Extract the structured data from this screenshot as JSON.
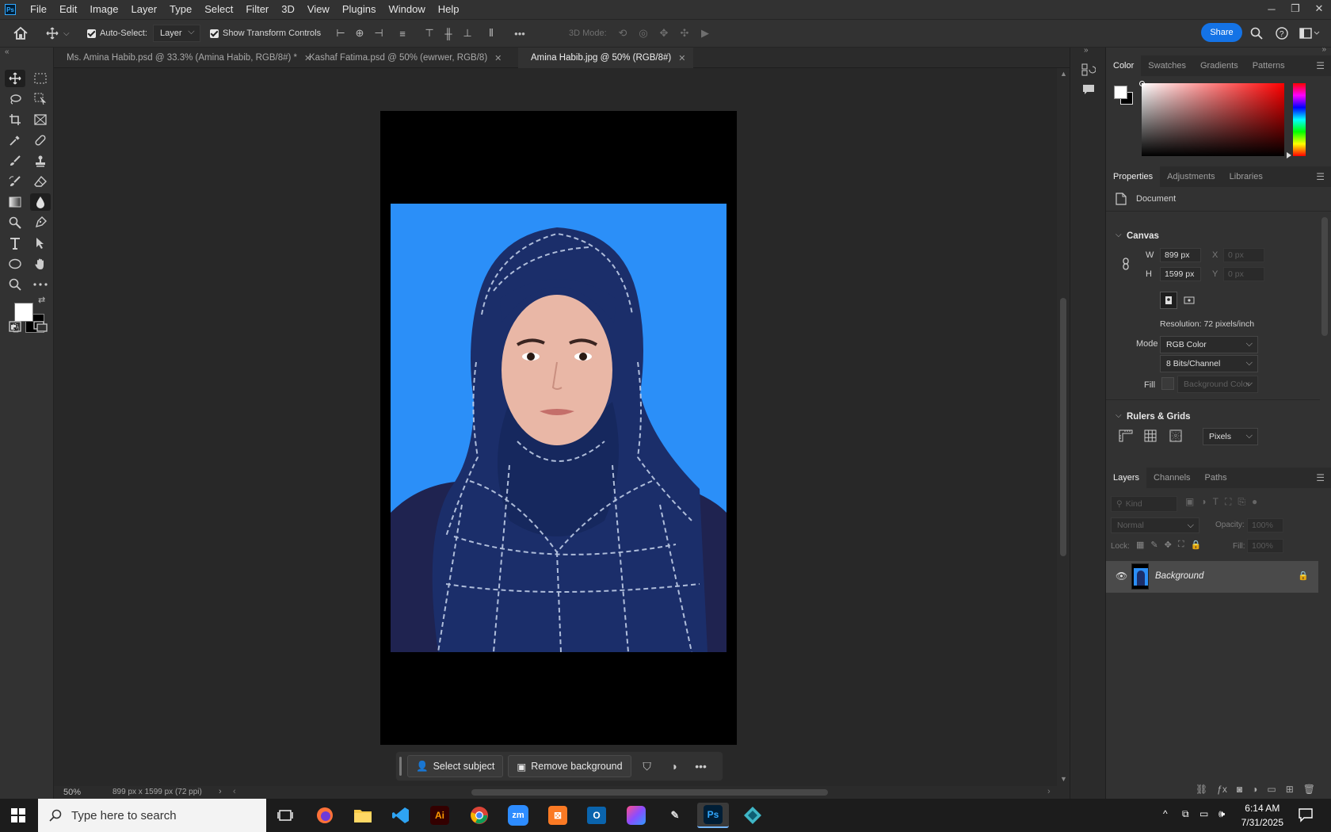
{
  "app": {
    "logo": "Ps",
    "menus": [
      "File",
      "Edit",
      "Image",
      "Layer",
      "Type",
      "Select",
      "Filter",
      "3D",
      "View",
      "Plugins",
      "Window",
      "Help"
    ]
  },
  "options": {
    "auto_select_label": "Auto-Select:",
    "auto_select_value": "Layer",
    "show_transform_label": "Show Transform Controls",
    "mode_3d_label": "3D Mode:",
    "share_label": "Share"
  },
  "tabs": [
    {
      "label": "Ms. Amina Habib.psd @ 33.3% (Amina Habib, RGB/8#) *"
    },
    {
      "label": "Kashaf Fatima.psd @ 50% (ewrwer, RGB/8)"
    },
    {
      "label": "Amina Habib.jpg @ 50% (RGB/8#)"
    }
  ],
  "context_bar": {
    "select_subject": "Select subject",
    "remove_background": "Remove background"
  },
  "status": {
    "zoom": "50%",
    "doc_info": "899 px x 1599 px (72 ppi)"
  },
  "color_panel": {
    "tabs": [
      "Color",
      "Swatches",
      "Gradients",
      "Patterns"
    ],
    "foreground": "#ffffff",
    "background": "#000000"
  },
  "properties_panel": {
    "tabs": [
      "Properties",
      "Adjustments",
      "Libraries"
    ],
    "doc_label": "Document",
    "canvas_heading": "Canvas",
    "w_label": "W",
    "w_value": "899 px",
    "h_label": "H",
    "h_value": "1599 px",
    "x_label": "X",
    "x_placeholder": "0 px",
    "y_label": "Y",
    "y_placeholder": "0 px",
    "resolution": "Resolution: 72 pixels/inch",
    "mode_label": "Mode",
    "mode_value": "RGB Color",
    "bits_value": "8 Bits/Channel",
    "fill_label": "Fill",
    "fill_value": "Background Color",
    "rulers_heading": "Rulers & Grids",
    "units_value": "Pixels"
  },
  "layers_panel": {
    "tabs": [
      "Layers",
      "Channels",
      "Paths"
    ],
    "kind_placeholder": "Kind",
    "blend_mode": "Normal",
    "opacity_label": "Opacity:",
    "opacity_value": "100%",
    "lock_label": "Lock:",
    "fill_label": "Fill:",
    "fill_value": "100%",
    "layers": [
      {
        "name": "Background"
      }
    ]
  },
  "taskbar": {
    "search_placeholder": "Type here to search",
    "time": "6:14 AM",
    "date": "7/31/2025"
  }
}
